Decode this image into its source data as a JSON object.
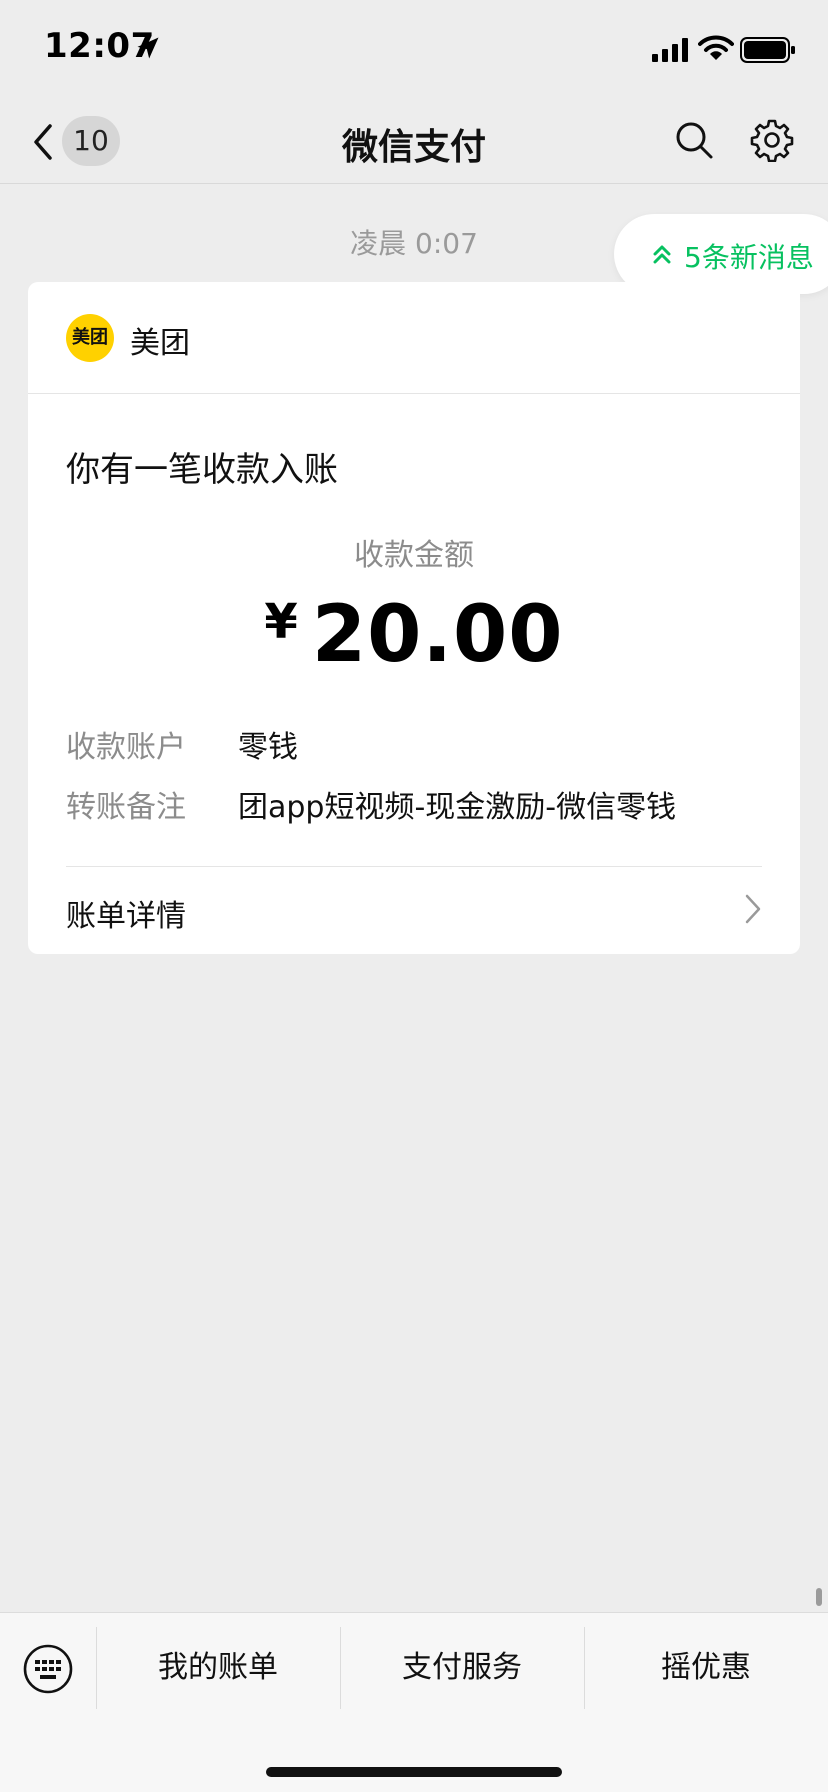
{
  "status_bar": {
    "time": "12:07"
  },
  "nav": {
    "unread_count": "10",
    "title": "微信支付"
  },
  "time_divider": "凌晨 0:07",
  "new_messages": {
    "label": "5条新消息",
    "color": "#07c160"
  },
  "card": {
    "merchant": {
      "logo_text": "美团",
      "name": "美团",
      "logo_color": "#ffd100"
    },
    "heading": "你有一笔收款入账",
    "amount_label": "收款金额",
    "currency": "¥",
    "amount": "20.00",
    "details": [
      {
        "label": "收款账户",
        "value": "零钱"
      },
      {
        "label": "转账备注",
        "value": "团app短视频-现金激励-微信零钱"
      }
    ],
    "bill_link_label": "账单详情"
  },
  "bottom_menu": {
    "items": [
      {
        "label": "我的账单"
      },
      {
        "label": "支付服务"
      },
      {
        "label": "摇优惠"
      }
    ]
  }
}
